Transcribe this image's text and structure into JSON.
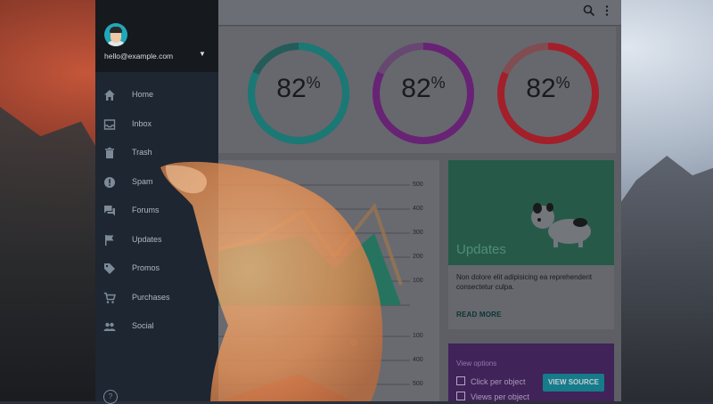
{
  "colors": {
    "teal": "#20918c",
    "purple": "#7c2a8b",
    "red": "#c32633",
    "sidebar": "#1d2631",
    "view_source": "#1b93a6",
    "skin": "#e99a63"
  },
  "topbar": {
    "icons": [
      "search-icon",
      "more-vert-icon"
    ]
  },
  "user": {
    "email": "hello@example.com"
  },
  "nav": [
    {
      "label": "Home",
      "icon": "home-icon"
    },
    {
      "label": "Inbox",
      "icon": "inbox-icon"
    },
    {
      "label": "Trash",
      "icon": "trash-icon"
    },
    {
      "label": "Spam",
      "icon": "spam-icon"
    },
    {
      "label": "Forums",
      "icon": "forum-icon"
    },
    {
      "label": "Updates",
      "icon": "flag-icon"
    },
    {
      "label": "Promos",
      "icon": "tag-icon"
    },
    {
      "label": "Purchases",
      "icon": "cart-icon"
    },
    {
      "label": "Social",
      "icon": "people-icon"
    }
  ],
  "stats": [
    {
      "value": "82",
      "unit": "%",
      "color": "teal"
    },
    {
      "value": "82",
      "unit": "%",
      "color": "purple"
    },
    {
      "value": "82",
      "unit": "%",
      "color": "red"
    }
  ],
  "chart": {
    "ticks_top": [
      "500",
      "400",
      "300",
      "200",
      "100"
    ],
    "ticks_bottom": [
      "100",
      "400",
      "500"
    ]
  },
  "updates": {
    "title": "Updates",
    "body": "Non dolore elit adipisicing ea reprehenderit consectetur culpa.",
    "action": "READ MORE"
  },
  "options": {
    "heading": "View options",
    "items": [
      "Click per object",
      "Views per object"
    ],
    "button": "VIEW SOURCE"
  }
}
